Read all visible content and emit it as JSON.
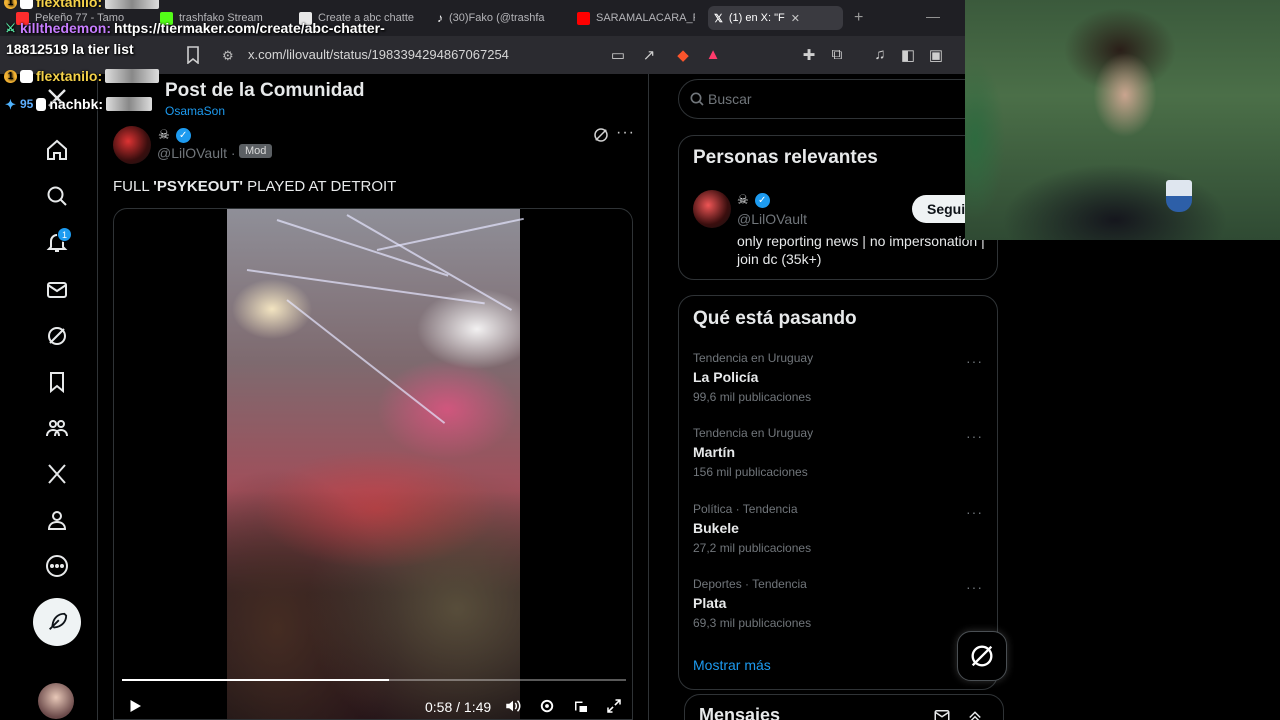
{
  "browser": {
    "tabs": [
      {
        "label": "Pekeño 77 - Tamo",
        "color": "#ff2d2d"
      },
      {
        "label": "trashfako Stream",
        "color": "#53fc18"
      },
      {
        "label": "Create a abc chatte",
        "color": "#e8e8e8"
      },
      {
        "label": "(30)Fako (@trashfa",
        "color": "#ffffff"
      },
      {
        "label": "SARAMALACARA_F",
        "color": "#ff0000"
      },
      {
        "label": "(1) en X: \"F",
        "color": "#ffffff",
        "active": true
      }
    ],
    "new_tab": "+",
    "minimize": "—",
    "url": "x.com/lilovault/status/1983394294867067254"
  },
  "chat": [
    {
      "user": "flextanilo:",
      "msg": "",
      "badge": "1"
    },
    {
      "user": "killthedemon:",
      "msg": "https://tiermaker.com/create/abc-chatter-"
    },
    {
      "user": "",
      "msg": "18812519 la tier list"
    },
    {
      "user": "flextanilo:",
      "msg": "",
      "badge": "1"
    },
    {
      "user": "nachbk:",
      "msg": "",
      "badge": "95"
    }
  ],
  "post": {
    "header_title": "Post de la Comunidad",
    "header_sub": "OsamaSon",
    "author_icon": "☠",
    "handle": "@LilOVault",
    "dot": "·",
    "mod_tag": "Mod",
    "more": "···",
    "text_before": "FULL ",
    "text_bold": "'PSYKEOUT'",
    "text_after": " PLAYED AT DETROIT"
  },
  "video": {
    "time": "0:58 / 1:49",
    "progress": 0.53
  },
  "sidebar": {
    "notif_count": "1"
  },
  "right": {
    "search_placeholder": "Buscar",
    "relevant_title": "Personas relevantes",
    "relevant_icon": "☠",
    "relevant_handle": "@LilOVault",
    "relevant_bio": "only reporting news | no impersonation | join dc (35k+)",
    "follow_label": "Seguir",
    "trends_title": "Qué está pasando",
    "trends": [
      {
        "context": "Tendencia en Uruguay",
        "name": "La Policía",
        "count": "99,6 mil publicaciones"
      },
      {
        "context": "Tendencia en Uruguay",
        "name": "Martín",
        "count": "156 mil publicaciones"
      },
      {
        "context": "Política · Tendencia",
        "name": "Bukele",
        "count": "27,2 mil publicaciones"
      },
      {
        "context": "Deportes · Tendencia",
        "name": "Plata",
        "count": "69,3 mil publicaciones"
      }
    ],
    "trend_more": "···",
    "show_more": "Mostrar más",
    "messages_title": "Mensajes"
  },
  "colors": {
    "accent": "#1d9bf0",
    "background": "#000000",
    "border": "#2f3336"
  }
}
